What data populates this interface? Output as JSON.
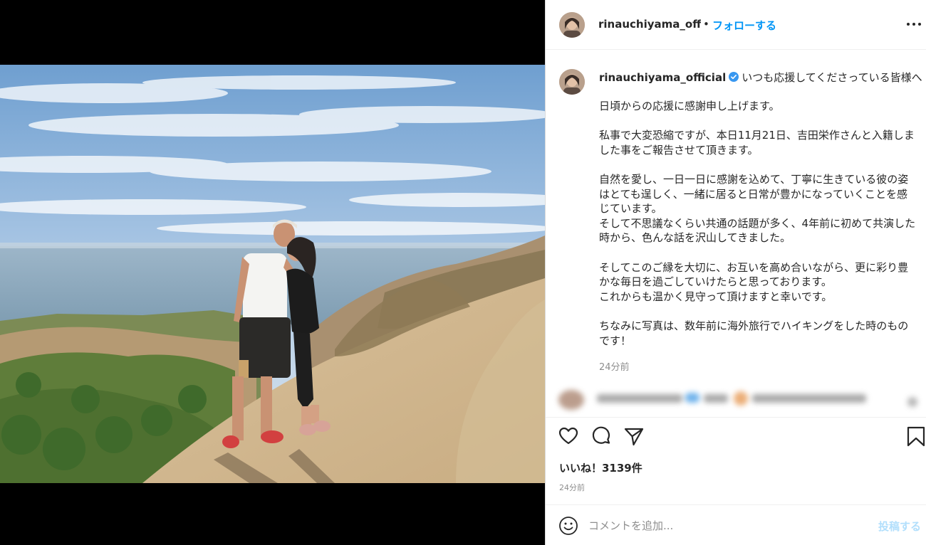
{
  "post": {
    "username": "rinauchiyama_official",
    "follow_label": "フォローする",
    "separator": "•",
    "caption_title": "いつも応援してくださっている皆様へ",
    "caption_body": "日頃からの応援に感謝申し上げます。\n\n私事で大変恐縮ですが、本日11月21日、吉田栄作さんと入籍しました事をご報告させて頂きます。\n\n自然を愛し、一日一日に感謝を込めて、丁寧に生きている彼の姿はとても逞しく、一緒に居ると日常が豊かになっていくことを感じています。\nそして不思議なくらい共通の話題が多く、4年前に初めて共演した時から、色んな話を沢山してきました。\n\nそしてこのご縁を大切に、お互いを高め合いながら、更に彩り豊かな毎日を過ごしていけたらと思っております。\nこれからも温かく見守って頂けますと幸いです。\n\nちなみに写真は、数年前に海外旅行でハイキングをした時のものです！",
    "caption_time": "24分前",
    "likes": "いいね！3139件",
    "post_time": "24分前"
  },
  "comment": {
    "placeholder": "コメントを追加...",
    "post_label": "投稿する"
  },
  "icons": {
    "verified": "verified-badge-icon",
    "more": "more-options-icon",
    "like": "heart-icon",
    "comment": "comment-bubble-icon",
    "share": "paper-plane-icon",
    "save": "bookmark-icon",
    "emoji": "smiley-icon"
  },
  "colors": {
    "link_blue": "#0095f6",
    "verified_blue": "#3897f0",
    "muted_text": "#8e8e8e",
    "disabled_blue": "#b2dffc"
  }
}
